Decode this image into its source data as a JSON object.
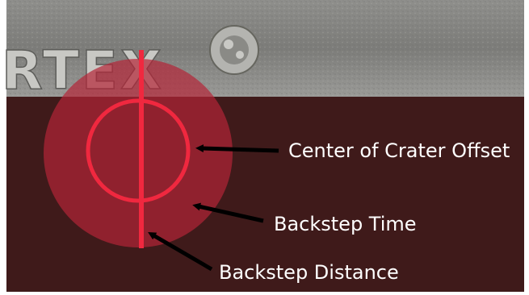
{
  "diagram": {
    "stamp_text": "RTEX",
    "labels": {
      "center_offset": "Center of Crater Offset",
      "backstep_time": "Backstep Time",
      "backstep_distance": "Backstep Distance"
    },
    "colors": {
      "plate_dark": "#3f1a1a",
      "metal_gray": "#8c8c89",
      "crater_disc": "#b32537",
      "guide_red": "#f0283f",
      "arrow": "#000000",
      "label_text": "#ffffff"
    }
  }
}
